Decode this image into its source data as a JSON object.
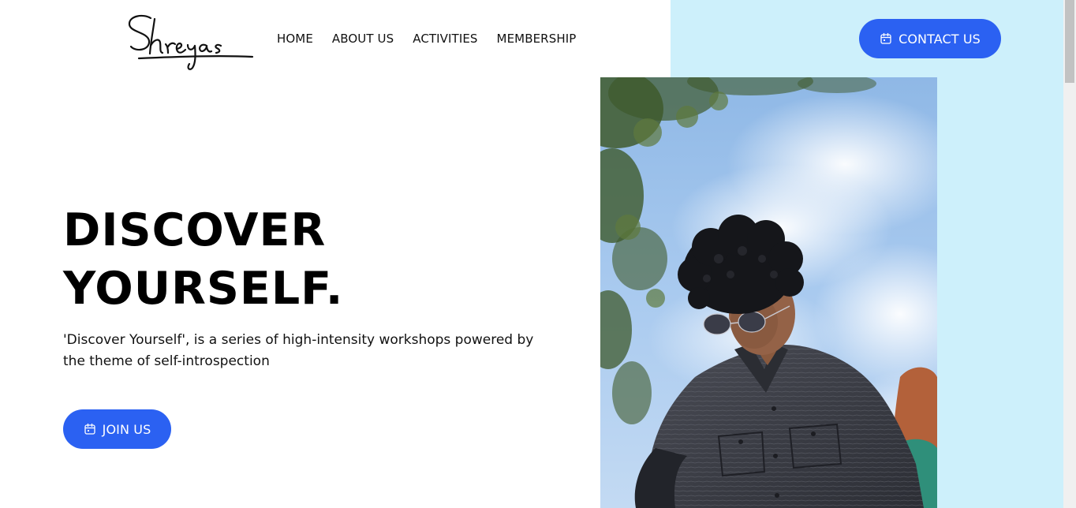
{
  "logo": {
    "text": "Shreyas"
  },
  "nav": {
    "items": [
      {
        "label": "HOME"
      },
      {
        "label": "ABOUT US"
      },
      {
        "label": "ACTIVITIES"
      },
      {
        "label": "MEMBERSHIP"
      }
    ]
  },
  "header": {
    "contact_label": "CONTACT US",
    "contact_icon": "calendar-icon"
  },
  "hero": {
    "title_line1": "DISCOVER",
    "title_line2": "YOURSELF.",
    "description": "'Discover Yourself', is a series of high-intensity workshops powered by the theme of self-introspection",
    "join_label": "JOIN US",
    "join_icon": "calendar-icon"
  },
  "colors": {
    "accent": "#2b61f2",
    "panel": "#cdf0fb",
    "text": "#111111"
  }
}
